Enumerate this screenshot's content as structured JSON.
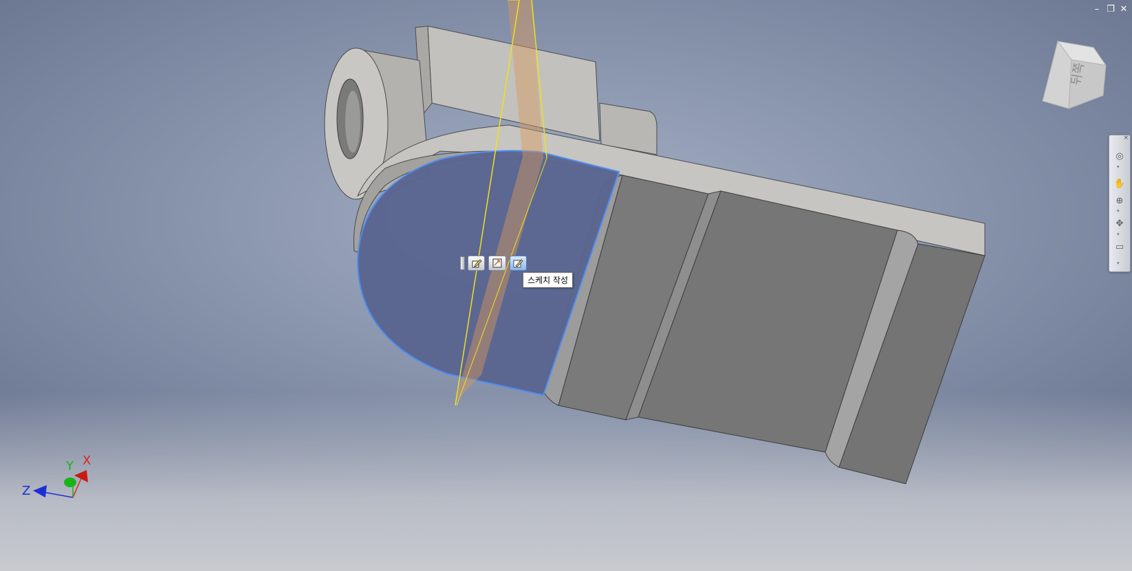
{
  "window": {
    "minimize_icon": "minimize-icon",
    "restore_icon": "restore-icon",
    "close_icon": "close-icon",
    "minimize_glyph": "–",
    "restore_glyph": "❐",
    "close_glyph": "✕"
  },
  "viewcube": {
    "face_label": "뒤",
    "face_label_full": "뒤쪽"
  },
  "navigation_bar": {
    "close_glyph": "×",
    "items": [
      {
        "name": "steering-wheel-icon",
        "glyph": "◎"
      },
      {
        "name": "pan-icon",
        "glyph": "✋"
      },
      {
        "name": "zoom-icon",
        "glyph": "⊕"
      },
      {
        "name": "orbit-icon",
        "glyph": "✥"
      },
      {
        "name": "look-at-icon",
        "glyph": "▭"
      }
    ],
    "more_glyph": "▾"
  },
  "mini_toolbar": {
    "buttons": [
      {
        "name": "edit-extrude-icon"
      },
      {
        "name": "edit-sketch-icon"
      },
      {
        "name": "create-sketch-icon",
        "active": true
      }
    ]
  },
  "tooltip": {
    "text": "스케치 작성"
  },
  "axis_triad": {
    "x_label": "X",
    "y_label": "Y",
    "z_label": "Z",
    "x_color": "#e0241b",
    "y_color": "#19b319",
    "z_color": "#1a2fd6"
  },
  "colors": {
    "selected_face": "#5a6590",
    "selection_edge": "#4f8df2",
    "work_plane_edge": "#f2e11a",
    "work_plane_fill": "#d99a5b",
    "part_light": "#b6b5b1",
    "part_dark": "#727272"
  }
}
